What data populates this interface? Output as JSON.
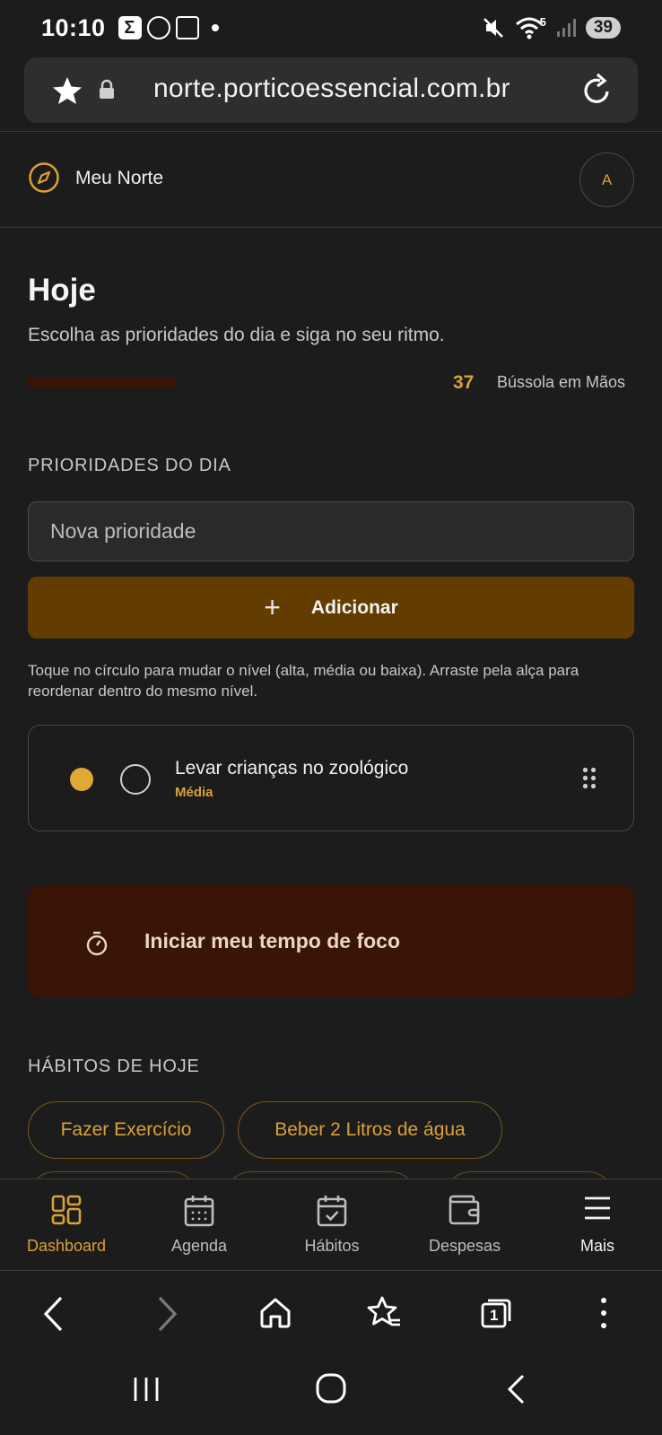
{
  "status_bar": {
    "time": "10:10",
    "left_icons": [
      "sigma-app-icon",
      "whatsapp-icon",
      "screenshot-icon",
      "notification-dot"
    ],
    "right_icons": [
      "mute-icon",
      "wifi-icon",
      "signal-icon"
    ],
    "wifi_badge": "5",
    "battery": "39"
  },
  "browser": {
    "url": "norte.porticoessencial.com.br"
  },
  "app": {
    "title": "Meu Norte",
    "avatar_initial": "A",
    "accent": "#d9a13a"
  },
  "today": {
    "title": "Hoje",
    "subtitle": "Escolha as prioridades do dia e siga no seu ritmo.",
    "score": "37",
    "score_label": "Bússola em Mãos"
  },
  "priorities": {
    "section_title": "PRIORIDADES DO DIA",
    "input_placeholder": "Nova prioridade",
    "add_label": "Adicionar",
    "hint": "Toque no círculo para mudar o nível (alta, média ou baixa). Arraste pela alça para reordenar dentro do mesmo nível.",
    "items": [
      {
        "text": "Levar crianças no zoológico",
        "level": "Média"
      }
    ]
  },
  "focus": {
    "label": "Iniciar meu tempo de foco"
  },
  "habits": {
    "section_title": "HÁBITOS DE HOJE",
    "items": [
      "Fazer Exercício",
      "Beber 2 Litros de água"
    ]
  },
  "bottom_nav": [
    {
      "label": "Dashboard",
      "icon": "dashboard-icon",
      "active": true
    },
    {
      "label": "Agenda",
      "icon": "calendar-icon",
      "active": false
    },
    {
      "label": "Hábitos",
      "icon": "calendar-check-icon",
      "active": false
    },
    {
      "label": "Despesas",
      "icon": "wallet-icon",
      "active": false
    },
    {
      "label": "Mais",
      "icon": "menu-icon",
      "active": false
    }
  ],
  "browser_toolbar": {
    "tab_count": "1"
  }
}
